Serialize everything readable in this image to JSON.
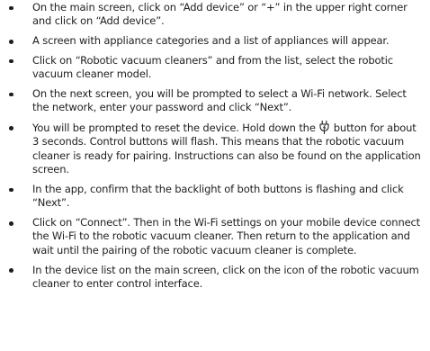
{
  "steps": [
    {
      "text": "On the main screen, click on “Add device” or “+” in the upper right corner and click on “Add device”."
    },
    {
      "text": "A screen with appliance categories and a list of appliances will appear."
    },
    {
      "text": "Click on “Robotic vacuum cleaners” and from the list, select the robotic vacuum cleaner model."
    },
    {
      "text": "On the next screen, you will be prompted to select a Wi-Fi network. Select the network, enter your password and click “Next”."
    },
    {
      "text_before_icon": "You will be prompted to reset the device. Hold down the",
      "icon": "power-plug-icon",
      "text_after_icon": "button for about 3 seconds. Control buttons will flash. This means that the robotic vacuum cleaner is ready for pairing. Instructions can also be found on the application screen."
    },
    {
      "text": "In the app, confirm that the backlight of both buttons is flashing and click “Next”."
    },
    {
      "text": "Click on “Connect”. Then in the Wi-Fi settings on your mobile device connect the Wi-Fi to the robotic vacuum cleaner. Then return to the application and wait until the pairing of the robotic vacuum cleaner is complete."
    },
    {
      "text": "In the device list on the main screen, click on the icon of the robotic vacuum cleaner to enter control interface."
    }
  ]
}
